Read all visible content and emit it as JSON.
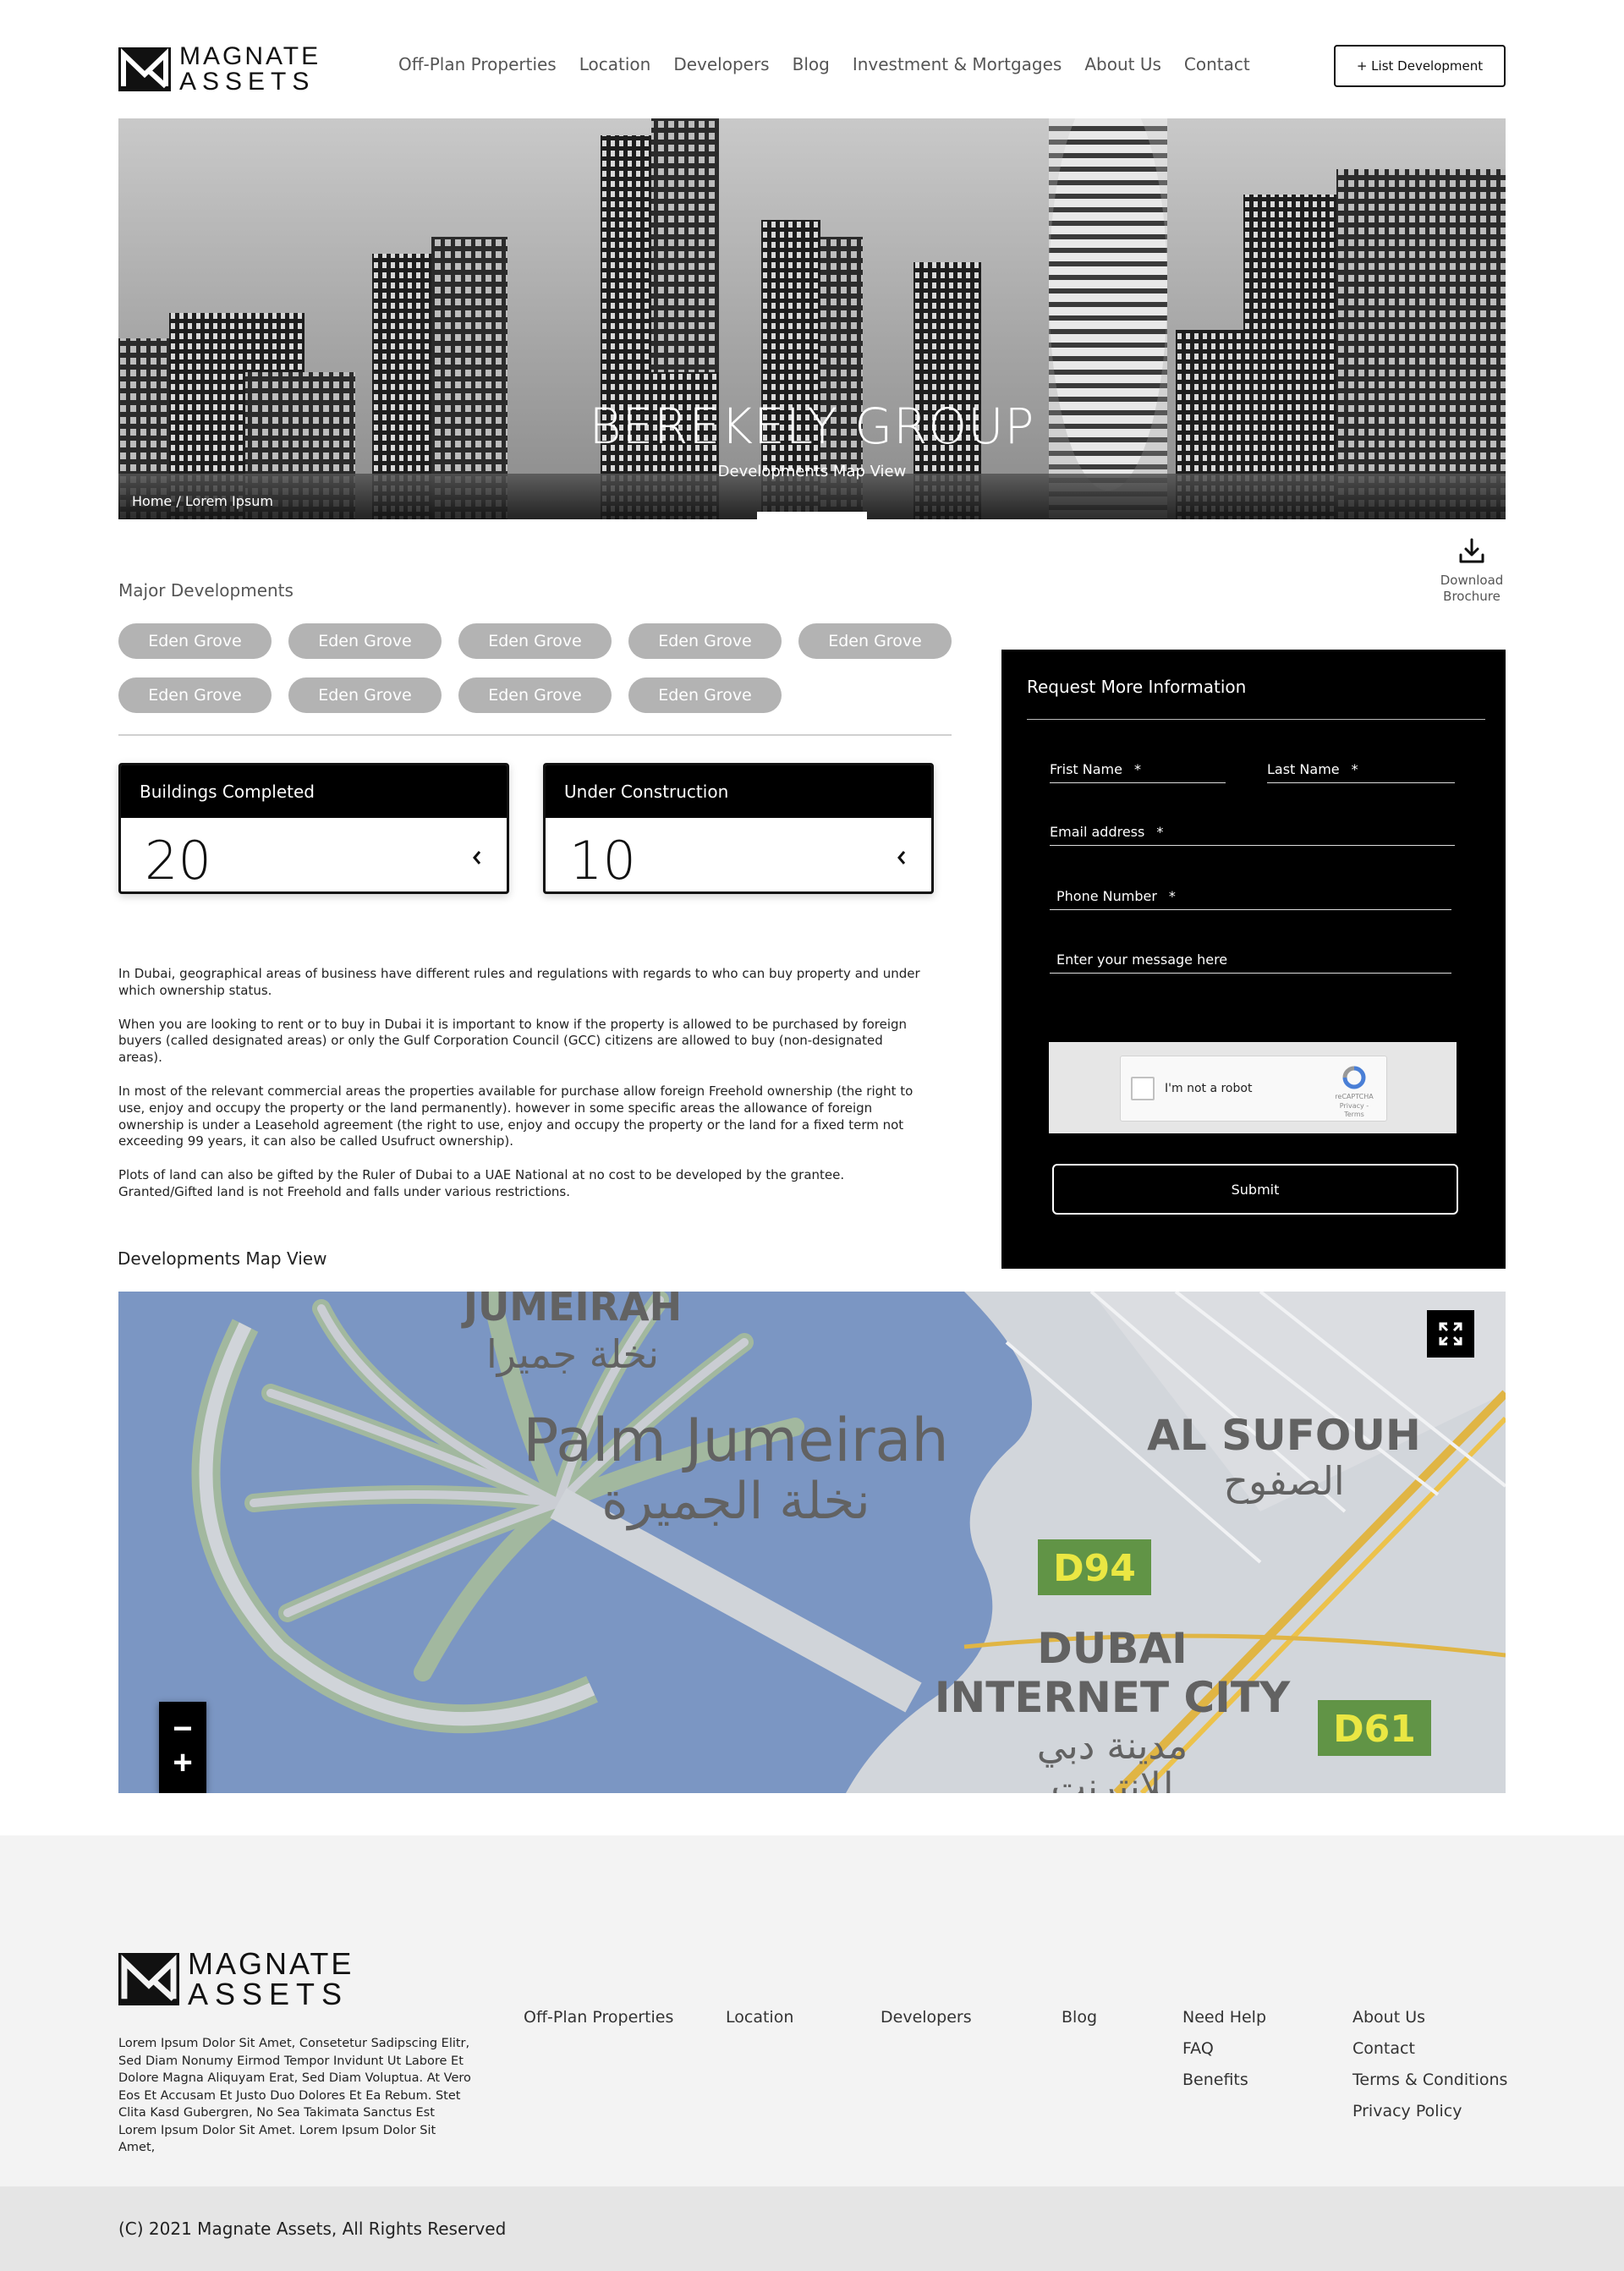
{
  "header": {
    "logo_line1": "MAGNATE",
    "logo_line2": "ASSETS",
    "nav": [
      "Off-Plan Properties",
      "Location",
      "Developers",
      "Blog",
      "Investment & Mortgages",
      "About Us",
      "Contact"
    ],
    "cta_label": "+ List Development"
  },
  "hero": {
    "title": "BEREKELY GROUP",
    "subtitle": "Developments Map View",
    "breadcrumb": "Home / Lorem Ipsum"
  },
  "download": {
    "label_line1": "Download",
    "label_line2": "Brochure",
    "icon": "download-icon"
  },
  "developments": {
    "heading": "Major Developments",
    "items": [
      "Eden Grove",
      "Eden Grove",
      "Eden Grove",
      "Eden Grove",
      "Eden Grove",
      "Eden Grove",
      "Eden Grove",
      "Eden Grove",
      "Eden Grove"
    ]
  },
  "stats": [
    {
      "label": "Buildings Completed",
      "value": "20"
    },
    {
      "label": "Under Construction",
      "value": "10"
    }
  ],
  "copy": [
    "In Dubai, geographical areas of business have different rules and regulations with regards to who can buy property and under which ownership status.",
    "When you are looking to rent or to buy in Dubai it is important to know if the property is allowed to be purchased by foreign buyers (called designated areas) or only the Gulf Corporation Council (GCC) citizens are allowed to buy (non-designated areas).",
    "In most of the relevant commercial areas the properties available for purchase allow foreign Freehold ownership (the right to use, enjoy and occupy the property or the land permanently). however in some specific areas the allowance of foreign ownership is under a Leasehold agreement (the right to use, enjoy and occupy the property or the land for a fixed term not exceeding 99 years, it can also be called Usufruct ownership).",
    "Plots of land can also be gifted by the Ruler of Dubai to a UAE National at no cost to be developed by the grantee. Granted/Gifted land is not Freehold and falls under various restrictions."
  ],
  "form": {
    "title": "Request More Information",
    "first_name": "Frist Name",
    "last_name": "Last Name",
    "email": "Email address",
    "phone": "Phone Number",
    "message": "Enter your message here",
    "required_mark": "*",
    "captcha_label": "I'm not a robot",
    "captcha_brand": "reCAPTCHA",
    "captcha_links": "Privacy - Terms",
    "submit_label": "Submit"
  },
  "map": {
    "heading": "Developments Map View",
    "labels": {
      "jumeirah_en": "JUMEIRAH",
      "jumeirah_ar": "نخلة جميرا",
      "palm_en": "Palm Jumeirah",
      "palm_ar": "نخلة الجميرة",
      "sufouh_en": "AL SUFOUH",
      "sufouh_ar": "الصفوح",
      "dic_line1": "DUBAI",
      "dic_line2": "INTERNET CITY",
      "dic_ar": "مدينة دبي",
      "dic_ar2": "للانترنت",
      "road1": "D94",
      "road2": "D61"
    },
    "zoom_out": "−",
    "zoom_in": "+"
  },
  "footer": {
    "about": "Lorem Ipsum Dolor Sit Amet, Consetetur Sadipscing Elitr, Sed Diam Nonumy Eirmod Tempor Invidunt Ut Labore Et Dolore Magna Aliquyam Erat, Sed Diam Voluptua. At Vero Eos Et Accusam Et Justo Duo Dolores Et Ea Rebum. Stet Clita Kasd Gubergren, No Sea Takimata Sanctus Est Lorem Ipsum Dolor Sit Amet. Lorem Ipsum Dolor Sit Amet,",
    "col1": [
      "Off-Plan Properties"
    ],
    "col2": [
      "Location"
    ],
    "col3": [
      "Developers"
    ],
    "col4": [
      "Blog"
    ],
    "col5": [
      "Need Help",
      "FAQ",
      "Benefits"
    ],
    "col6": [
      "About Us",
      "Contact",
      "Terms & Conditions",
      "Privacy Policy"
    ],
    "copyright": "(C) 2021 Magnate Assets, All Rights Reserved"
  },
  "colors": {
    "black": "#000000",
    "pill": "#b3b3b3",
    "water": "#5e7fb7",
    "footer_bg": "#f3f3f3",
    "road_badge": "#3f7d1e"
  }
}
